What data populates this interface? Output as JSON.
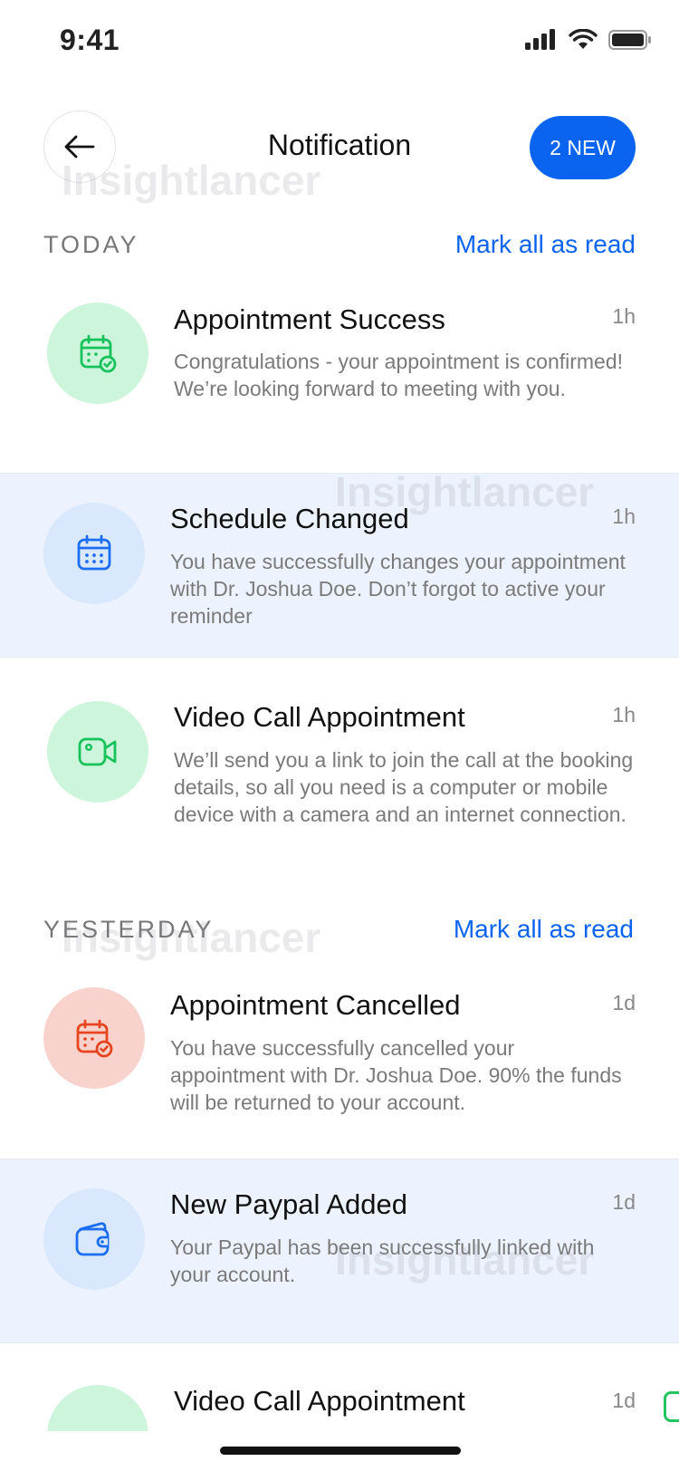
{
  "status_bar": {
    "time": "9:41"
  },
  "header": {
    "title": "Notification",
    "new_badge": "2 NEW"
  },
  "sections": {
    "today": {
      "label": "TODAY",
      "mark_all": "Mark all as read"
    },
    "yesterday": {
      "label": "YESTERDAY",
      "mark_all": "Mark all as read"
    }
  },
  "notifications": [
    {
      "title": "Appointment Success",
      "body": "Congratulations - your appointment is confirmed! We’re looking forward to meeting with you.",
      "time": "1h",
      "icon": "calendar-check-icon",
      "color": "#16c25a"
    },
    {
      "title": "Schedule Changed",
      "body": "You have successfully changes your appointment with Dr. Joshua Doe. Don’t forgot to active your reminder",
      "time": "1h",
      "icon": "calendar-icon",
      "color": "#1b6ef2"
    },
    {
      "title": "Video Call Appointment",
      "body": "We’ll send you a link to join the call at the booking details, so all you need is a computer or mobile device with a camera and an internet connection.",
      "time": "1h",
      "icon": "video-camera-icon",
      "color": "#16c25a"
    },
    {
      "title": "Appointment Cancelled",
      "body": "You have successfully cancelled your appointment with Dr. Joshua Doe. 90% the funds will be returned to your account.",
      "time": "1d",
      "icon": "calendar-cancel-icon",
      "color": "#e6451f"
    },
    {
      "title": "New Paypal Added",
      "body": "Your Paypal  has been successfully linked with your account.",
      "time": "1d",
      "icon": "wallet-icon",
      "color": "#1b6ef2"
    },
    {
      "title": "Video Call Appointment",
      "body": "",
      "time": "1d",
      "icon": "video-camera-icon",
      "color": "#16c25a"
    }
  ],
  "watermark": "Insightlancer"
}
